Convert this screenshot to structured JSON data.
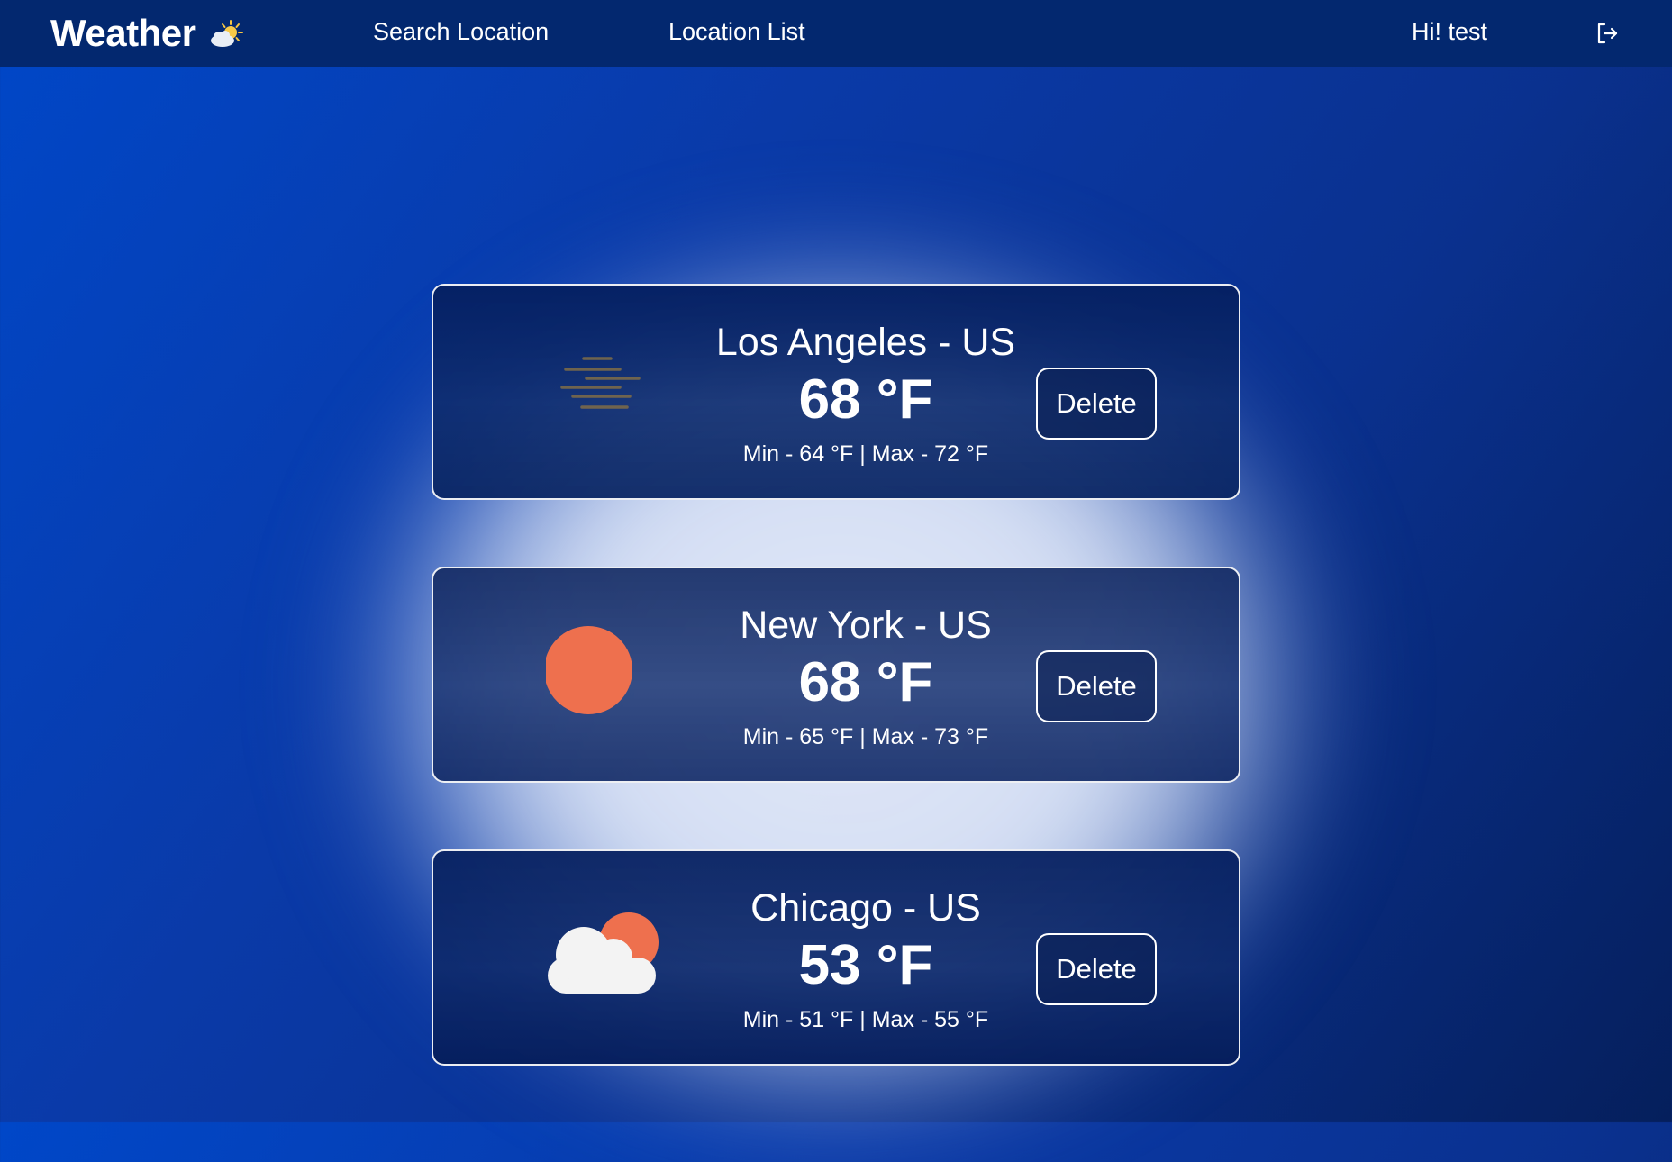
{
  "navbar": {
    "brand": "Weather",
    "brand_icon": "sun-behind-cloud-icon",
    "links": [
      {
        "label": "Search Location"
      },
      {
        "label": "Location List"
      }
    ],
    "greeting": "Hi! test",
    "logout_icon": "logout-icon"
  },
  "locations": [
    {
      "city": "Los Angeles - US",
      "temp": "68 °F",
      "minmax": "Min - 64 °F | Max - 72 °F",
      "icon": "haze-fog-icon",
      "delete_label": "Delete"
    },
    {
      "city": "New York - US",
      "temp": "68 °F",
      "minmax": "Min - 65 °F | Max - 73 °F",
      "icon": "clear-sun-icon",
      "delete_label": "Delete"
    },
    {
      "city": "Chicago - US",
      "temp": "53 °F",
      "minmax": "Min - 51 °F | Max - 55 °F",
      "icon": "partly-cloudy-icon",
      "delete_label": "Delete"
    }
  ],
  "colors": {
    "navbar": "#03286f",
    "sun": "#ee704e",
    "cloud": "#f3f3f3",
    "haze": "#7a6a4a"
  }
}
